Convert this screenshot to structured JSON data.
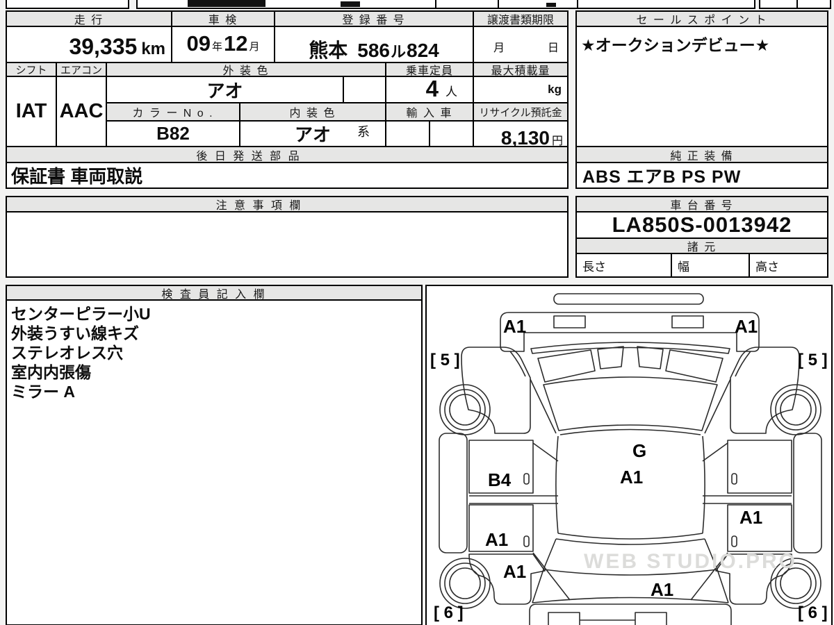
{
  "header_row": {
    "mileage_label": "走 行",
    "shaken_label": "車 検",
    "registration_label": "登 録 番 号",
    "transfer_docs_label": "譲渡書類期限",
    "sales_point_label": "セ ー ル ス ポ イ ン ト"
  },
  "values_row": {
    "mileage": "39,335",
    "mileage_unit": "km",
    "shaken_year": "09",
    "shaken_year_unit": "年",
    "shaken_month": "12",
    "shaken_month_unit": "月",
    "registration_region": "熊本",
    "registration_number": "586",
    "registration_kana": "ル",
    "registration_serial": "824",
    "transfer_month_unit": "月",
    "transfer_day_unit": "日",
    "sales_point": "★オークションデビュー★"
  },
  "spec_row": {
    "shift_label": "シフト",
    "shift": "IAT",
    "aircon_label": "エアコン",
    "aircon": "AAC",
    "exterior_color_label": "外 装 色",
    "exterior_color": "アオ",
    "capacity_label": "乗車定員",
    "capacity": "4",
    "capacity_unit": "人",
    "max_load_label": "最大積載量",
    "max_load_unit": "kg",
    "color_no_label": "カ ラ ー N o .",
    "color_no": "B82",
    "interior_color_label": "内 装 色",
    "interior_color": "アオ",
    "interior_color_suffix": "系",
    "import_label": "輸 入 車",
    "recycle_label": "リサイクル預託金",
    "recycle_fee": "8,130",
    "recycle_fee_unit": "円"
  },
  "parts": {
    "label": "後 日 発 送 部 品",
    "value": "保証書 車両取説"
  },
  "equipment": {
    "label": "純 正 装 備",
    "value": "ABS エアB PS PW"
  },
  "notes": {
    "label": "注 意 事 項 欄"
  },
  "chassis": {
    "label": "車 台 番 号",
    "number": "LA850S-0013942",
    "spec_label": "諸 元",
    "length_label": "長さ",
    "width_label": "幅",
    "height_label": "高さ"
  },
  "inspector": {
    "label": "検 査 員 記 入 欄",
    "lines": [
      "センターピラー小U",
      "外装うすい線キズ",
      "ステレオレス穴",
      "室内内張傷",
      "ミラー A"
    ]
  },
  "diagram": {
    "labels": [
      "A1",
      "A1",
      "[ 5 ]",
      "[ 5 ]",
      "G",
      "B4",
      "A1",
      "A1",
      "A1",
      "A1",
      "A1",
      "[ 6 ]",
      "[ 6 ]"
    ],
    "watermark": "WEB STUDIO.PRO"
  }
}
